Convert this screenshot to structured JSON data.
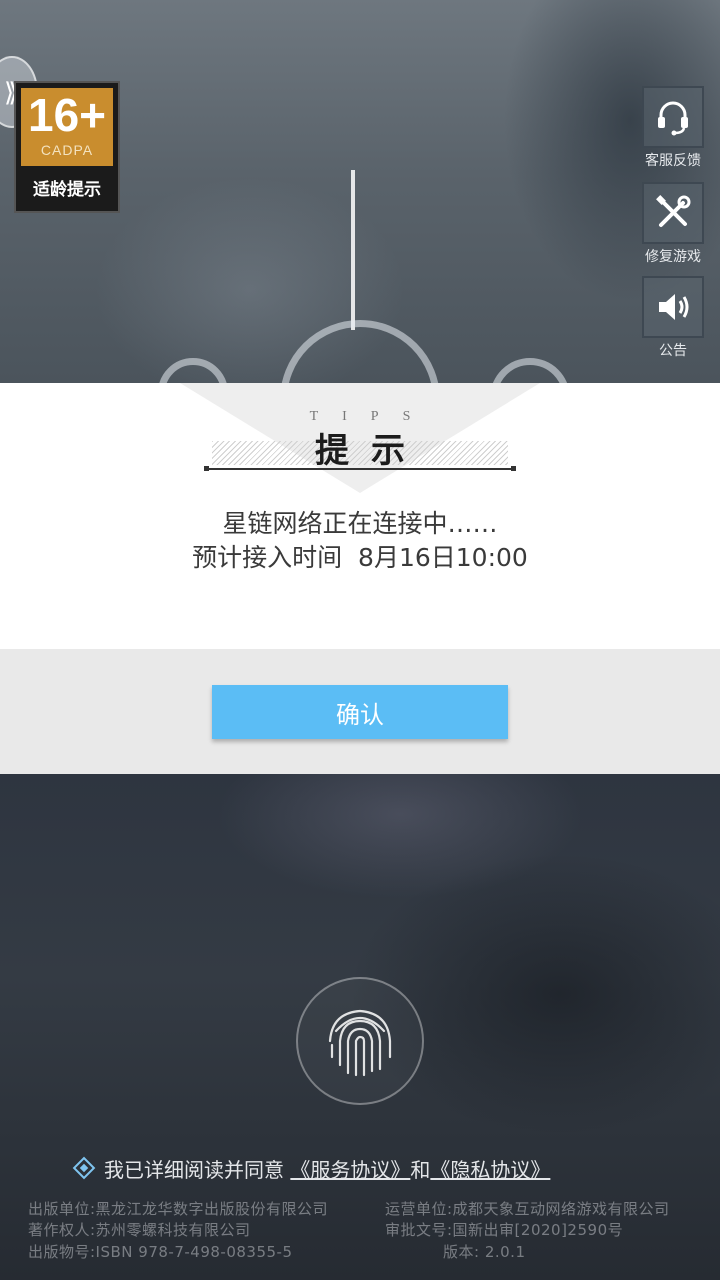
{
  "rating": {
    "age": "16+",
    "org": "CADPA",
    "label": "适龄提示"
  },
  "side_buttons": [
    {
      "label": "客服反馈",
      "icon": "headset-icon"
    },
    {
      "label": "修复游戏",
      "icon": "wrench-screwdriver-icon"
    },
    {
      "label": "公告",
      "icon": "speaker-icon"
    }
  ],
  "dialog": {
    "tips_small": "TIPS",
    "title": "提示",
    "line1": "星链网络正在连接中……",
    "line2": "预计接入时间  8月16日10:00",
    "confirm_label": "确认"
  },
  "agreement": {
    "prefix": "我已详细阅读并同意",
    "service_link": "《服务协议》",
    "and": "和",
    "privacy_link": "《隐私协议》"
  },
  "legal": {
    "publisher": "出版单位:黑龙江龙华数字出版股份有限公司",
    "operator": "运营单位:成都天象互动网络游戏有限公司",
    "copyright": "著作权人:苏州零螺科技有限公司",
    "approval": "审批文号:国新出审[2020]2590号",
    "isbn": "出版物号:ISBN 978-7-498-08355-5",
    "version": "版本: 2.0.1"
  },
  "colors": {
    "confirm_button": "#5bbdf5",
    "rating_badge": "#c98d2e"
  }
}
